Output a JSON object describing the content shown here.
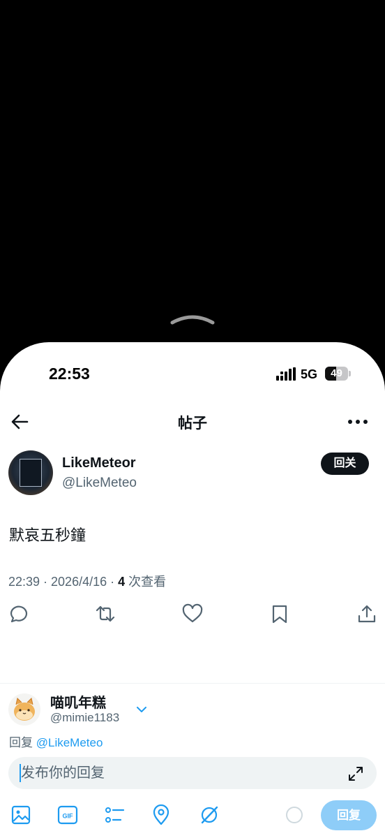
{
  "status_bar": {
    "time": "22:53",
    "network": "5G",
    "battery_level": "49",
    "battery_fraction": 0.49
  },
  "nav": {
    "title": "帖子"
  },
  "post": {
    "author_name": "LikeMeteor",
    "author_handle": "@LikeMeteo",
    "follow_back_label": "回关",
    "text": "默哀五秒鐘",
    "timestamp": "22:39 · 2026/4/16 · ",
    "view_count": "4",
    "view_label": " 次查看"
  },
  "reply": {
    "account_name": "喵叽年糕",
    "account_handle": "@mimie1183",
    "reply_prefix": "回复 ",
    "reply_mention": "@LikeMeteo",
    "placeholder": "发布你的回复",
    "submit_label": "回复"
  },
  "colors": {
    "accent": "#1d9bf0",
    "text": "#0f1419",
    "secondary": "#536471",
    "reply_disabled": "#8ecdf8"
  },
  "icons": [
    "chevron-up-icon",
    "signal-icon",
    "battery-icon",
    "back-arrow-icon",
    "more-icon",
    "comment-icon",
    "repost-icon",
    "like-icon",
    "bookmark-icon",
    "share-icon",
    "chevron-down-icon",
    "expand-icon",
    "image-icon",
    "gif-icon",
    "poll-icon",
    "location-icon",
    "grok-icon"
  ]
}
